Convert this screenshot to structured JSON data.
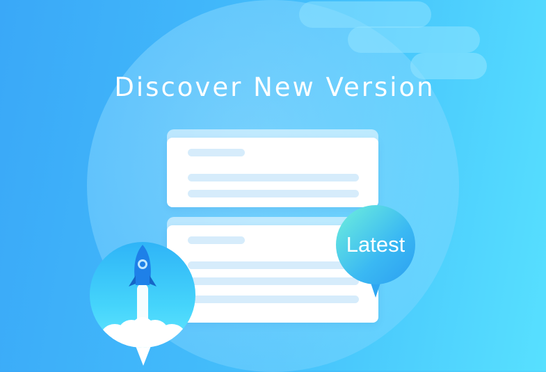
{
  "banner": {
    "title": "Discover New Version",
    "badge_label": "Latest"
  },
  "colors": {
    "background_start": "#3aa8f8",
    "background_end": "#57e0ff",
    "card": "#ffffff",
    "placeholder_line": "#d6ecfb",
    "badge_start": "#6ff0dc",
    "badge_end": "#2c9ff0",
    "rocket_body": "#1e80e8"
  },
  "icons": {
    "rocket": "rocket-icon",
    "speech_bubble": "speech-bubble-icon"
  }
}
